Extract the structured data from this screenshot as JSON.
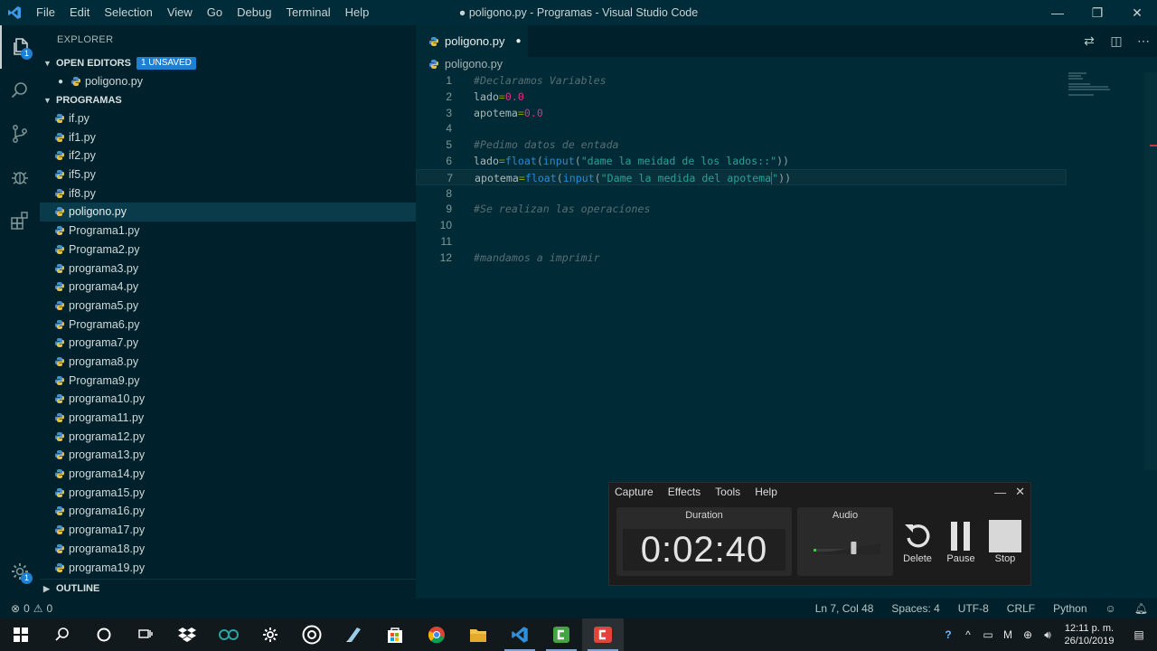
{
  "window": {
    "title": "● poligono.py - Programas - Visual Studio Code",
    "menu": [
      "File",
      "Edit",
      "Selection",
      "View",
      "Go",
      "Debug",
      "Terminal",
      "Help"
    ],
    "minimize": "—",
    "restore": "❐",
    "close": "✕"
  },
  "activity": {
    "explorer_badge": "1",
    "settings_badge": "1"
  },
  "sidebar": {
    "title": "EXPLORER",
    "open_editors": {
      "label": "OPEN EDITORS",
      "badge": "1 UNSAVED",
      "items": [
        "poligono.py"
      ]
    },
    "folder": {
      "label": "PROGRAMAS",
      "files": [
        "if.py",
        "if1.py",
        "if2.py",
        "if5.py",
        "if8.py",
        "poligono.py",
        "Programa1.py",
        "Programa2.py",
        "programa3.py",
        "programa4.py",
        "programa5.py",
        "Programa6.py",
        "programa7.py",
        "programa8.py",
        "Programa9.py",
        "programa10.py",
        "programa11.py",
        "programa12.py",
        "programa13.py",
        "programa14.py",
        "programa15.py",
        "programa16.py",
        "programa17.py",
        "programa18.py",
        "programa19.py"
      ],
      "selected": "poligono.py"
    },
    "outline": "OUTLINE"
  },
  "tab": {
    "label": "poligono.py",
    "dirty": "●"
  },
  "breadcrumb": "poligono.py",
  "editor": {
    "lines": [
      {
        "n": "1",
        "tokens": [
          [
            "cmt",
            "#Declaramos Variables"
          ]
        ]
      },
      {
        "n": "2",
        "tokens": [
          [
            "var",
            "lado"
          ],
          [
            "op",
            "="
          ],
          [
            "num",
            "0.0"
          ]
        ]
      },
      {
        "n": "3",
        "tokens": [
          [
            "var",
            "apotema"
          ],
          [
            "op",
            "="
          ],
          [
            "num",
            "0.0"
          ]
        ]
      },
      {
        "n": "4",
        "tokens": []
      },
      {
        "n": "5",
        "tokens": [
          [
            "cmt",
            "#Pedimo datos de entada"
          ]
        ]
      },
      {
        "n": "6",
        "tokens": [
          [
            "var",
            "lado"
          ],
          [
            "op",
            "="
          ],
          [
            "fn",
            "float"
          ],
          [
            "pun",
            "("
          ],
          [
            "fn",
            "input"
          ],
          [
            "pun",
            "("
          ],
          [
            "str",
            "\"dame la meidad de los lados::\""
          ],
          [
            "pun",
            "))"
          ]
        ]
      },
      {
        "n": "7",
        "tokens": [
          [
            "var",
            "apotema"
          ],
          [
            "op",
            "="
          ],
          [
            "fn",
            "float"
          ],
          [
            "pun",
            "("
          ],
          [
            "fn",
            "input"
          ],
          [
            "pun",
            "("
          ],
          [
            "str",
            "\"Dame la medida del apotema"
          ],
          [
            "cursor",
            ""
          ],
          [
            "str",
            "\""
          ],
          [
            "pun",
            "))"
          ]
        ],
        "current": true
      },
      {
        "n": "8",
        "tokens": []
      },
      {
        "n": "9",
        "tokens": [
          [
            "cmt",
            "#Se realizan las operaciones"
          ]
        ]
      },
      {
        "n": "10",
        "tokens": []
      },
      {
        "n": "11",
        "tokens": []
      },
      {
        "n": "12",
        "tokens": [
          [
            "cmt",
            "#mandamos a imprimir"
          ]
        ]
      }
    ]
  },
  "status": {
    "errors": "0",
    "warnings": "0",
    "position": "Ln 7, Col 48",
    "spaces": "Spaces: 4",
    "encoding": "UTF-8",
    "eol": "CRLF",
    "language": "Python"
  },
  "recorder": {
    "menu": [
      "Capture",
      "Effects",
      "Tools",
      "Help"
    ],
    "duration_label": "Duration",
    "duration": "0:02:40",
    "audio_label": "Audio",
    "audio_level": 0.6,
    "delete": "Delete",
    "pause": "Pause",
    "stop": "Stop"
  },
  "taskbar": {
    "time": "12:11 p. m.",
    "date": "26/10/2019"
  },
  "colors": {
    "editor_bg": "#002b36",
    "sidebar_bg": "#00212b",
    "accent": "#1f7fd1"
  }
}
